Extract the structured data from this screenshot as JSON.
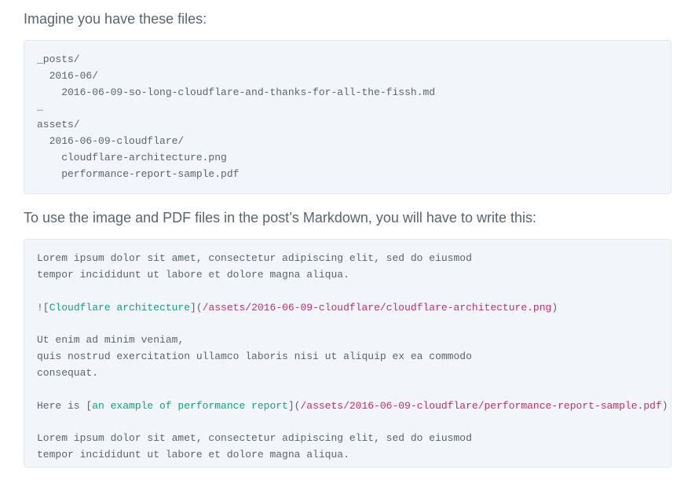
{
  "intro1": "Imagine you have these files:",
  "code1": "_posts/\n  2016-06/\n    2016-06-09-so-long-cloudflare-and-thanks-for-all-the-fissh.md\n…\nassets/\n  2016-06-09-cloudflare/\n    cloudflare-architecture.png\n    performance-report-sample.pdf",
  "intro2": "To use the image and PDF files in the post’s Markdown, you will have to write this:",
  "code2": {
    "l1": "Lorem ipsum dolor sit amet, consectetur adipiscing elit, sed do eiusmod",
    "l2": "tempor incididunt ut labore et dolore magna aliqua.",
    "l3_a": "![",
    "l3_b": "Cloudflare architecture",
    "l3_c": "](",
    "l3_d": "/assets/2016-06-09-cloudflare/cloudflare-architecture.png",
    "l3_e": ")",
    "l4": "Ut enim ad minim veniam,",
    "l5": "quis nostrud exercitation ullamco laboris nisi ut aliquip ex ea commodo",
    "l6": "consequat.",
    "l7_a": "Here is [",
    "l7_b": "an example of performance report",
    "l7_c": "](",
    "l7_d": "/assets/2016-06-09-cloudflare/performance-report-sample.pdf",
    "l7_e": ")",
    "l8": "Lorem ipsum dolor sit amet, consectetur adipiscing elit, sed do eiusmod",
    "l9": "tempor incididunt ut labore et dolore magna aliqua."
  }
}
